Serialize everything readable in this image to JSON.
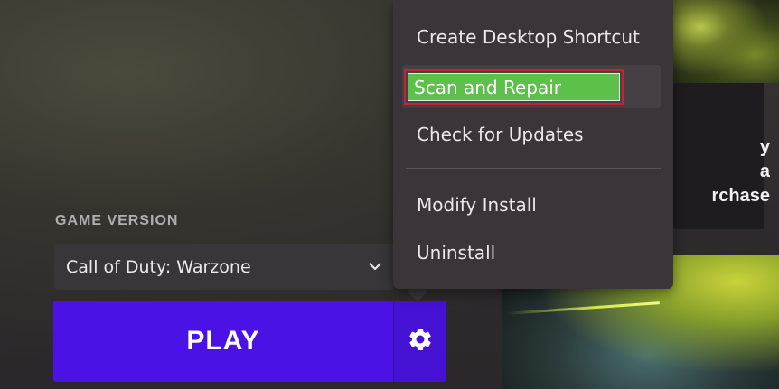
{
  "background": {
    "promo_card_text": "y\na\nrchase"
  },
  "game_version": {
    "label": "GAME VERSION",
    "selected": "Call of Duty: Warzone"
  },
  "play": {
    "label": "PLAY",
    "settings_icon": "gear-icon"
  },
  "context_menu": {
    "items": [
      {
        "label": "Create Desktop Shortcut"
      },
      {
        "label": "Scan and Repair",
        "highlighted": true
      },
      {
        "label": "Check for Updates"
      },
      {
        "label": "Modify Install"
      },
      {
        "label": "Uninstall"
      }
    ]
  },
  "colors": {
    "play_button": "#4b12e6",
    "menu_bg": "#3b3439",
    "highlight_fill": "#5cc04a",
    "highlight_border": "#c0282f"
  }
}
